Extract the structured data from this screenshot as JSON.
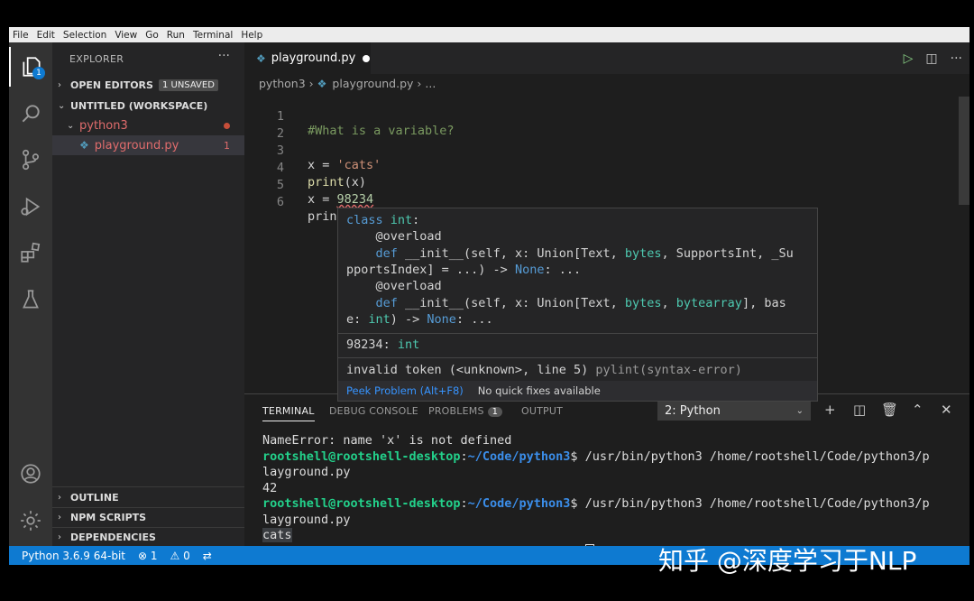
{
  "menubar": [
    "File",
    "Edit",
    "Selection",
    "View",
    "Go",
    "Run",
    "Terminal",
    "Help"
  ],
  "activity": {
    "explorer_badge": "1",
    "icons": [
      "files-icon",
      "search-icon",
      "source-control-icon",
      "run-debug-icon",
      "extensions-icon",
      "test-flask-icon",
      "account-icon",
      "settings-gear-icon"
    ]
  },
  "sidebar": {
    "title": "EXPLORER",
    "more": "···",
    "open_editors": "OPEN EDITORS",
    "unsaved": "1 UNSAVED",
    "workspace": "UNTITLED (WORKSPACE)",
    "folder": "python3",
    "file": "playground.py",
    "file_problems": "1",
    "outline": "OUTLINE",
    "npm_scripts": "NPM SCRIPTS",
    "dependencies": "DEPENDENCIES"
  },
  "editor": {
    "tab_label": "playground.py",
    "breadcrumb_folder": "python3",
    "breadcrumb_file": "playground.py",
    "breadcrumb_more": "...",
    "lines": [
      {
        "n": "1",
        "text": "#What is a variable?"
      },
      {
        "n": "2",
        "text": ""
      },
      {
        "n": "3",
        "a": "x = ",
        "s": "'cats'"
      },
      {
        "n": "4",
        "f": "print",
        "r": "(x)"
      },
      {
        "n": "5",
        "a": "x = ",
        "num": "98234"
      },
      {
        "n": "6",
        "text": "prin"
      }
    ]
  },
  "hover": {
    "l1_kw": "class",
    "l1_ty": "int",
    "l1_rest": ":",
    "l2": "    @overload",
    "l3_kw": "    def",
    "l3_a": " __init__(self, x: Union[Text, ",
    "l3_b": "bytes",
    "l3_c": ", SupportsInt, _Su",
    "l4_a": "pportsIndex] = ...) -> ",
    "l4_none": "None",
    "l4_b": ": ...",
    "l5": "    @overload",
    "l6_kw": "    def",
    "l6_a": " __init__(self, x: Union[Text, ",
    "l6_b": "bytes",
    "l6_c": ", ",
    "l6_d": "bytearray",
    "l6_e": "], bas",
    "l7_a": "e: ",
    "l7_ty": "int",
    "l7_b": ") -> ",
    "l7_none": "None",
    "l7_c": ": ...",
    "value_num": "98234",
    "value_sep": ": ",
    "value_type": "int",
    "problem": "invalid token (<unknown>, line 5)",
    "problem_src": "pylint(syntax-error)",
    "peek": "Peek Problem (Alt+F8)",
    "no_fix": "No quick fixes available"
  },
  "panel": {
    "tabs": [
      "TERMINAL",
      "DEBUG CONSOLE",
      "PROBLEMS",
      "OUTPUT"
    ],
    "problems_count": "1",
    "terminal_select": "2: Python",
    "terminal": {
      "l1": "NameError: name 'x' is not defined",
      "prompt": "rootshell@rootshell-desktop",
      "colon": ":",
      "path": "~/Code/python3",
      "dollar": "$",
      "cmd1": " /usr/bin/python3 /home/rootshell/Code/python3/p",
      "cont1": "layground.py",
      "out1": "42",
      "cmd2": " /usr/bin/python3 /home/rootshell/Code/python3/p",
      "cont2": "layground.py",
      "out2": "cats"
    }
  },
  "status": {
    "interpreter": "Python 3.6.9 64-bit",
    "errors": "⊗ 1",
    "warnings": "⚠ 0"
  },
  "watermark": "知乎 @深度学习于NLP"
}
